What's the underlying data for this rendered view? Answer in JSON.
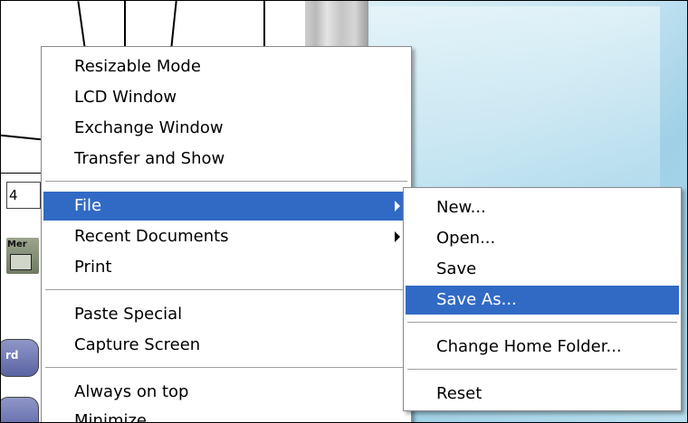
{
  "background": {
    "field_value": "4",
    "mem_label": "Mer",
    "side_button_label": "rd"
  },
  "main_menu": {
    "items": [
      {
        "label": "Resizable Mode"
      },
      {
        "label": "LCD Window"
      },
      {
        "label": "Exchange Window"
      },
      {
        "label": "Transfer and Show"
      },
      {
        "label": "File"
      },
      {
        "label": "Recent Documents"
      },
      {
        "label": "Print"
      },
      {
        "label": "Paste Special"
      },
      {
        "label": "Capture Screen"
      },
      {
        "label": "Always on top"
      },
      {
        "label": "Minimize"
      }
    ]
  },
  "file_submenu": {
    "items": [
      {
        "label": "New..."
      },
      {
        "label": "Open..."
      },
      {
        "label": "Save"
      },
      {
        "label": "Save As..."
      },
      {
        "label": "Change Home Folder..."
      },
      {
        "label": "Reset"
      }
    ]
  },
  "colors": {
    "highlight": "#316ac5"
  }
}
